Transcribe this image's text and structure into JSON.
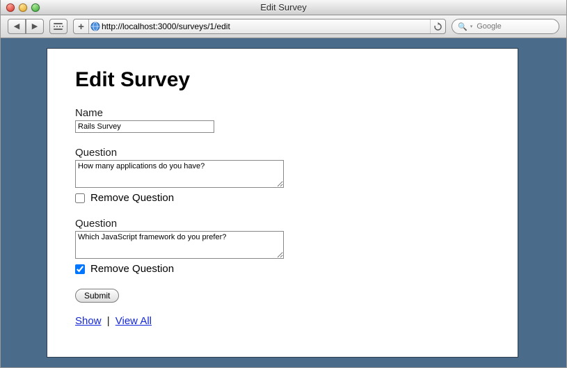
{
  "window": {
    "title": "Edit Survey"
  },
  "toolbar": {
    "url": "http://localhost:3000/surveys/1/edit",
    "search_placeholder": "Google"
  },
  "page": {
    "heading": "Edit Survey",
    "name_label": "Name",
    "name_value": "Rails Survey",
    "questions": [
      {
        "label": "Question",
        "text": "How many applications do you have?",
        "remove_label": "Remove Question",
        "remove_checked": false
      },
      {
        "label": "Question",
        "text": "Which JavaScript framework do you prefer?",
        "remove_label": "Remove Question",
        "remove_checked": true
      }
    ],
    "submit_label": "Submit",
    "links": {
      "show": "Show",
      "sep": " | ",
      "view_all": "View All"
    }
  }
}
